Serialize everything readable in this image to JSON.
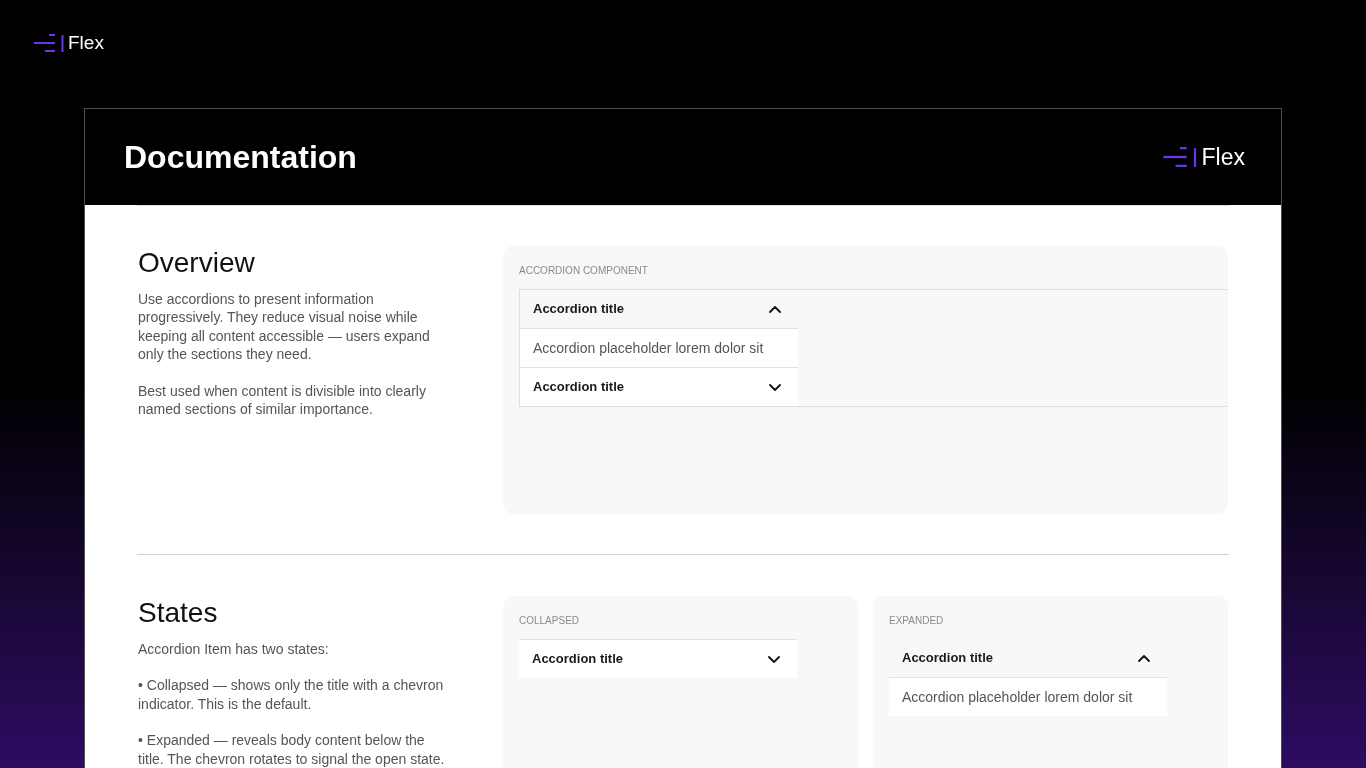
{
  "brand": {
    "name": "Flex"
  },
  "card": {
    "title": "Documentation",
    "brand": "Flex",
    "sections": [
      {
        "heading": "Overview",
        "paragraphs": [
          "Use accordions to present information progressively. They reduce visual noise while keeping all content accessible — users expand only the sections they need.",
          "Best used when content is divisible into clearly named sections of similar importance."
        ],
        "demos": [
          {
            "label": "ACCORDION COMPONENT",
            "framed": true,
            "items": [
              {
                "title": "Accordion title",
                "expanded": true,
                "body": "Accordion placeholder lorem dolor sit"
              },
              {
                "title": "Accordion title",
                "expanded": false
              }
            ]
          }
        ]
      },
      {
        "heading": "States",
        "paragraphs": [
          "Accordion Item has two states:",
          "• Collapsed — shows only the title with a chevron indicator. This is the default.",
          "• Expanded — reveals body content below the title. The chevron rotates to signal the open state."
        ],
        "demos": [
          {
            "label": "COLLAPSED",
            "framed": false,
            "items": [
              {
                "title": "Accordion title",
                "expanded": false
              }
            ]
          },
          {
            "label": "EXPANDED",
            "framed": false,
            "items": [
              {
                "title": "Accordion title",
                "expanded": true,
                "body": "Accordion placeholder lorem dolor sit"
              }
            ]
          }
        ]
      }
    ]
  }
}
